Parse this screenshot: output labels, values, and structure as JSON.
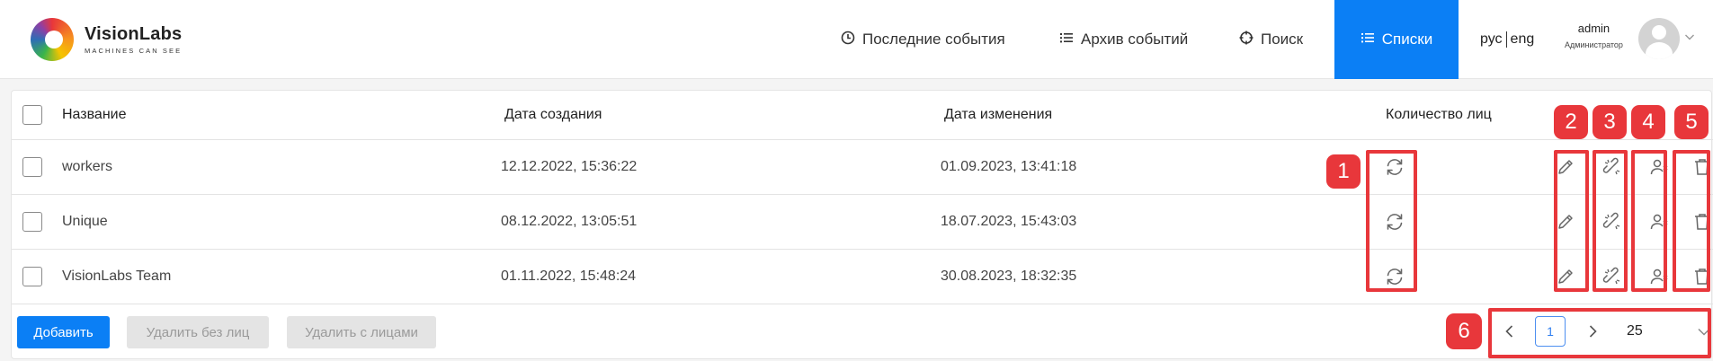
{
  "header": {
    "logo": {
      "name": "VisionLabs",
      "tagline": "MACHINES CAN SEE"
    },
    "nav": [
      {
        "label": "Последние события",
        "icon": "clock-icon"
      },
      {
        "label": "Архив событий",
        "icon": "list-icon"
      },
      {
        "label": "Поиск",
        "icon": "crosshair-icon"
      },
      {
        "label": "Списки",
        "icon": "list-icon",
        "active": true
      }
    ],
    "lang": {
      "ru": "рус",
      "en": "eng"
    },
    "user": {
      "name": "admin",
      "role": "Администратор"
    }
  },
  "table": {
    "columns": [
      "Название",
      "Дата создания",
      "Дата изменения",
      "Количество лиц"
    ],
    "rows": [
      {
        "name": "workers",
        "created": "12.12.2022, 15:36:22",
        "modified": "01.09.2023, 13:41:18"
      },
      {
        "name": "Unique",
        "created": "08.12.2022, 13:05:51",
        "modified": "18.07.2023, 15:43:03"
      },
      {
        "name": "VisionLabs Team",
        "created": "01.11.2022, 15:48:24",
        "modified": "30.08.2023, 18:32:35"
      }
    ]
  },
  "footer": {
    "add_label": "Добавить",
    "delete_no_faces_label": "Удалить без лиц",
    "delete_with_faces_label": "Удалить с лицами"
  },
  "pagination": {
    "current_page": "1",
    "per_page": "25"
  },
  "annotations": [
    "1",
    "2",
    "3",
    "4",
    "5",
    "6"
  ],
  "colors": {
    "accent": "#0b7ff5",
    "annotation": "#e8373b"
  }
}
